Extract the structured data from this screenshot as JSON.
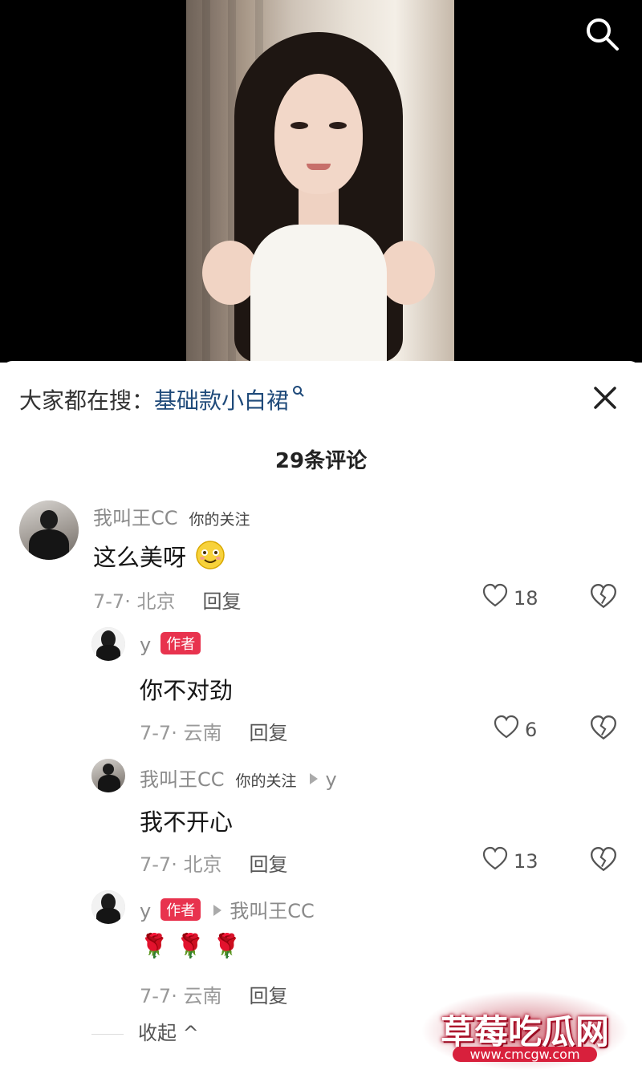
{
  "search": {
    "icon": "search-icon"
  },
  "suggestion": {
    "prefix": "大家都在搜：",
    "query": "基础款小白裙"
  },
  "comment_count": "29条评论",
  "comments": [
    {
      "user": "我叫王CC",
      "follow_tag": "你的关注",
      "text": "这么美呀",
      "date_loc": "7-7· 北京",
      "reply": "回复",
      "likes": "18"
    },
    {
      "user": "y",
      "author_tag": "作者",
      "text": "你不对劲",
      "date_loc": "7-7· 云南",
      "reply": "回复",
      "likes": "6"
    },
    {
      "user": "我叫王CC",
      "follow_tag": "你的关注",
      "reply_to": "y",
      "text": "我不开心",
      "date_loc": "7-7· 北京",
      "reply": "回复",
      "likes": "13"
    },
    {
      "user": "y",
      "author_tag": "作者",
      "reply_to": "我叫王CC",
      "text": "🌹 🌹 🌹",
      "date_loc": "7-7· 云南",
      "reply": "回复"
    }
  ],
  "collapse_label": "收起 ^",
  "watermark": {
    "title": "草莓吃瓜网",
    "url": "www.cmcgw.com"
  },
  "colors": {
    "author_tag": "#e8334e",
    "query_link": "#1f4a7a"
  }
}
